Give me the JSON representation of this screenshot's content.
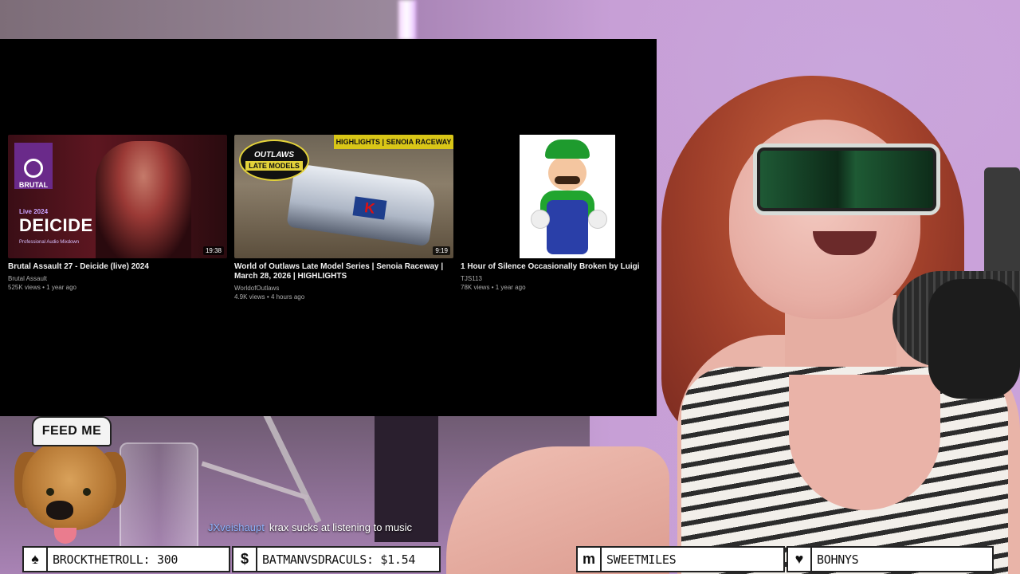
{
  "videos": [
    {
      "title": "Brutal Assault 27 - Deicide (live) 2024",
      "channel": "Brutal Assault",
      "views": "525K views",
      "age": "1 year ago",
      "duration": "19:38",
      "thumb_logo": "BRUTAL",
      "thumb_year": "Live 2024",
      "thumb_band": "DEICIDE",
      "thumb_sub": "Professional Audio Mixdown"
    },
    {
      "title": "World of Outlaws Late Model Series | Senoia Raceway | March 28, 2026 | HIGHLIGHTS",
      "channel": "WorldofOutlaws",
      "views": "4.9K views",
      "age": "4 hours ago",
      "duration": "9:19",
      "thumb_banner": "HIGHLIGHTS | SENOIA RACEWAY",
      "thumb_badge_top": "OUTLAWS",
      "thumb_badge_bottom": "LATE MODELS"
    },
    {
      "title": "1 Hour of Silence Occasionally Broken by Luigi",
      "channel": "TJS113",
      "views": "78K views",
      "age": "1 year ago"
    }
  ],
  "chat": {
    "username": "JXveishaupt",
    "message": "krax sucks at listening to music"
  },
  "emote": {
    "hat_text": "FEED ME"
  },
  "alerts": [
    {
      "icon": "spade-icon",
      "glyph": "♠",
      "text": "BROCKTHETROLL: 300"
    },
    {
      "icon": "dollar-icon",
      "glyph": "$",
      "text": "BATMANVSDRACULS: $1.54"
    },
    {
      "icon": "m-logo-icon",
      "glyph": "m",
      "text": "SWEETMILES"
    },
    {
      "icon": "heart-icon",
      "glyph": "♥",
      "text": "BOHNYS"
    }
  ],
  "colors": {
    "panel": "#000000",
    "chat_username": "#8fb4ff",
    "accent_purple": "#c79fd6"
  }
}
